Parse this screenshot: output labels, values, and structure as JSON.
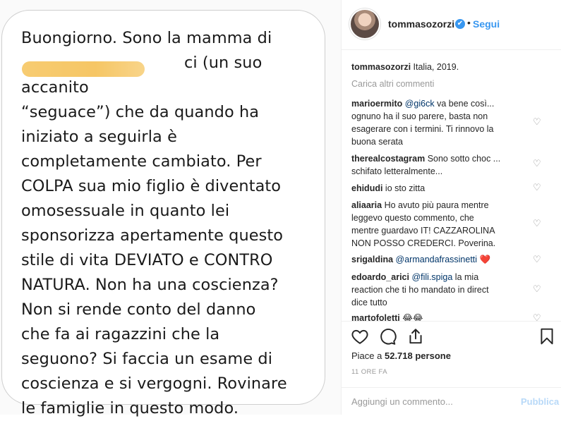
{
  "post": {
    "text": "Buongiorno. Sono la mamma di\n                                ci (un suo accanito\n“seguace”) che da quando ha\niniziato a seguirla è\ncompletamente cambiato. Per\nCOLPA sua mio figlio è diventato\nomosessuale in quanto lei\nsponsorizza apertamente questo\nstile di vita DEVIATO e CONTRO\nNATURA. Non ha una coscienza?\nNon si rende conto del danno\nche fa ai ragazzini che la\nseguono? Si faccia un esame di\ncoscienza e si vergogni. Rovinare\nle famiglie in questo modo."
  },
  "header": {
    "username": "tommasozorzi",
    "verified_glyph": "✔",
    "separator": "•",
    "follow_label": "Segui"
  },
  "caption": {
    "username": "tommasozorzi",
    "text": "Italia, 2019."
  },
  "load_more_label": "Carica altri commenti",
  "comments": [
    {
      "user": "marioermito",
      "mention": "@gi6ck",
      "lines": [
        " va bene così...",
        "ognuno ha il suo parere, basta non",
        "esagerare con i termini. Ti rinnovo la",
        "buona serata"
      ]
    },
    {
      "user": "therealcostagram",
      "mention": "",
      "lines": [
        " Sono sotto choc ...",
        "schifato letteralmente..."
      ]
    },
    {
      "user": "ehidudi",
      "mention": "",
      "lines": [
        " io sto zitta"
      ]
    },
    {
      "user": "aliaaria",
      "mention": "",
      "lines": [
        " Ho avuto più paura mentre",
        "leggevo questo commento, che",
        "mentre guardavo IT! CAZZAROLINA",
        "NON POSSO CREDERCI. Poverina."
      ]
    },
    {
      "user": "srigaldina",
      "mention": "@armandafrassinetti",
      "lines": [
        " ",
        ""
      ],
      "emoji": "❤️"
    },
    {
      "user": "edoardo_arici",
      "mention": "@fili.spiga",
      "lines": [
        " la mia",
        "reaction che ti ho mandato in direct",
        "dice tutto"
      ]
    },
    {
      "user": "martofoletti",
      "mention": "",
      "lines": [
        " 😂😂"
      ]
    }
  ],
  "actions": {
    "likes_prefix": "Piace a ",
    "likes_count": "52.718",
    "likes_suffix": " persone",
    "time": "11 ORE FA",
    "comment_placeholder": "Aggiungi un commento...",
    "publish_label": "Pubblica"
  },
  "colors": {
    "accent": "#3897f0",
    "redaction": "#f5c35d",
    "heart_red": "#ed4956"
  }
}
